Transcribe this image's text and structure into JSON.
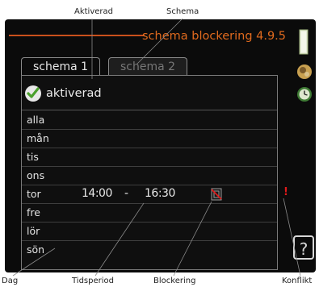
{
  "callouts": {
    "aktiverad": "Aktiverad",
    "schema": "Schema",
    "dag": "Dag",
    "tidsperiod": "Tidsperiod",
    "blockering": "Blockering",
    "konflikt": "Konflikt"
  },
  "screen": {
    "title": "schema blockering 4.9.5",
    "tabs": [
      "schema 1",
      "schema 2"
    ],
    "active_label": "aktiverad",
    "days": [
      "alla",
      "mån",
      "tis",
      "ons",
      "tor",
      "fre",
      "lör",
      "sön"
    ],
    "time_period": {
      "start": "14:00",
      "dash": "-",
      "end": "16:30"
    },
    "conflict_mark": "!",
    "help_label": "?"
  },
  "colors": {
    "title": "#e06a1e",
    "accent_line": "#c9501c",
    "conflict": "#e01a1a",
    "check": "#4aa02c",
    "screen_bg": "#0b0b0b"
  },
  "icons": {
    "check": "checkmark-icon",
    "blocking": "blocked-compressor-icon",
    "side": [
      "thermometer-bar-icon",
      "heat-pump-icon",
      "clock-icon"
    ]
  }
}
